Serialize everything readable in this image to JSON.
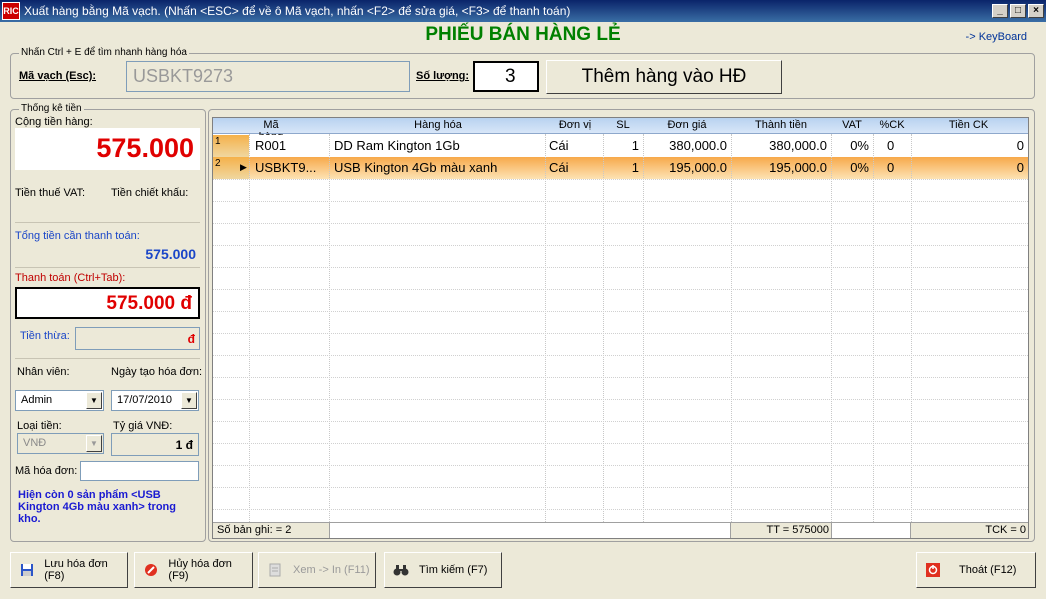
{
  "window": {
    "title": "Xuất hàng bằng Mã vạch. (Nhấn <ESC> để về ô Mã vạch, nhấn <F2> để sửa giá, <F3> để thanh toán)",
    "icon_text": "RIC"
  },
  "header": {
    "title": "PHIẾU BÁN HÀNG LẺ",
    "keyboard_link": "-> KeyBoard"
  },
  "search": {
    "legend": "Nhấn Ctrl + E để tìm nhanh hàng hóa",
    "barcode_label": "Mã vạch (Esc):",
    "barcode_value": "USBKT9273",
    "qty_label": "Số lượng:",
    "qty_value": "3",
    "add_button": "Thêm hàng vào HĐ"
  },
  "stats": {
    "legend": "Thống kê tiền",
    "total_goods_label": "Cộng tiền hàng:",
    "total_goods_value": "575.000",
    "vat_label": "Tiền thuế VAT:",
    "discount_label": "Tiền chiết khấu:",
    "total_pay_label": "Tổng tiền cần thanh toán:",
    "total_pay_value": "575.000",
    "payment_label": "Thanh toán (Ctrl+Tab):",
    "payment_value": "575.000 đ",
    "change_label": "Tiền thừa:",
    "change_value": "đ",
    "staff_label": "Nhân viên:",
    "date_label": "Ngày tạo hóa đơn:",
    "staff_value": "Admin",
    "date_value": "17/07/2010",
    "currency_label": "Loại tiền:",
    "rate_label": "Tỷ giá VNĐ:",
    "currency_value": "VNĐ",
    "rate_value": "1 đ",
    "invoice_label": "Mã hóa đơn:",
    "invoice_value": "",
    "stock_note": "Hiện còn 0 sản phẩm <USB Kington 4Gb màu xanh> trong kho."
  },
  "grid": {
    "columns": [
      "Mã hàng",
      "Hàng hóa",
      "Đơn vị",
      "SL",
      "Đơn giá",
      "Thành tiền",
      "VAT",
      "%CK",
      "Tiền CK"
    ],
    "rows": [
      {
        "num": "1",
        "code": "R001",
        "name": "DD Ram Kington 1Gb",
        "unit": "Cái",
        "qty": "1",
        "price": "380,000.0",
        "amount": "380,000.0",
        "vat": "0%",
        "ck": "0",
        "tienck": "0"
      },
      {
        "num": "2",
        "code": "USBKT9...",
        "name": "USB Kington 4Gb màu xanh",
        "unit": "Cái",
        "qty": "1",
        "price": "195,000.0",
        "amount": "195,000.0",
        "vat": "0%",
        "ck": "0",
        "tienck": "0"
      }
    ],
    "footer": {
      "count": "Số bản ghi: = 2",
      "total": "TT = 575000",
      "tck": "TCK = 0"
    }
  },
  "buttons": {
    "save": "Lưu hóa đơn (F8)",
    "cancel": "Hủy hóa đơn (F9)",
    "print": "Xem -> In (F11)",
    "find": "Tìm kiếm (F7)",
    "exit": "Thoát (F12)"
  }
}
